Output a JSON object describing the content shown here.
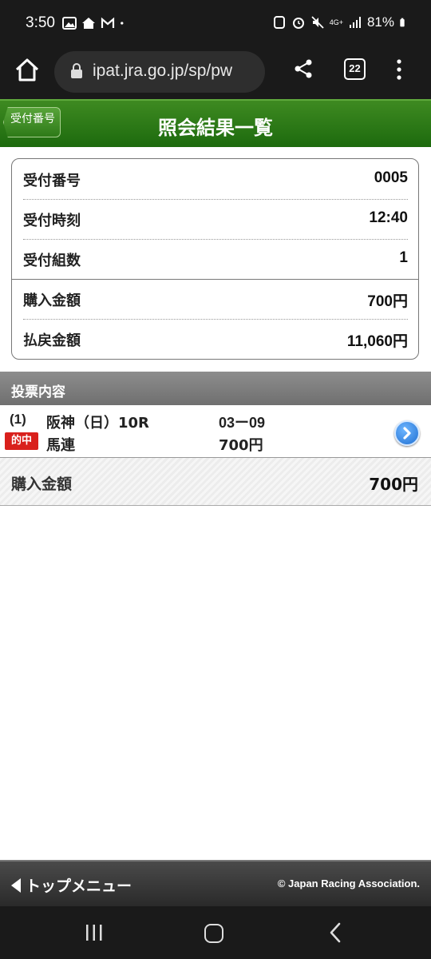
{
  "status_bar": {
    "time": "3:50",
    "signal_label": "4G+",
    "battery": "81%"
  },
  "browser": {
    "url": "ipat.jra.go.jp/sp/pw",
    "tab_count": "22"
  },
  "header": {
    "back_label": "受付番号",
    "title": "照会結果一覧"
  },
  "summary": {
    "rows": [
      {
        "label": "受付番号",
        "value": "0005"
      },
      {
        "label": "受付時刻",
        "value": "12:40"
      },
      {
        "label": "受付組数",
        "value": "1"
      },
      {
        "label": "購入金額",
        "value": "700円"
      },
      {
        "label": "払戻金額",
        "value": "11,060円"
      }
    ]
  },
  "bets_section": {
    "title": "投票内容",
    "items": [
      {
        "number": "(1)",
        "status_badge": "的中",
        "race": "阪神（日）10R",
        "bet_type": "馬連",
        "combination": "03ー09",
        "amount": "700円"
      }
    ],
    "total_label": "購入金額",
    "total_value": "700円"
  },
  "footer": {
    "menu_label": "トップメニュー",
    "copyright": "© Japan Racing Association."
  },
  "colors": {
    "header_green": "#2e7a18",
    "hit_red": "#d9201c",
    "detail_blue": "#1f6fd2"
  }
}
